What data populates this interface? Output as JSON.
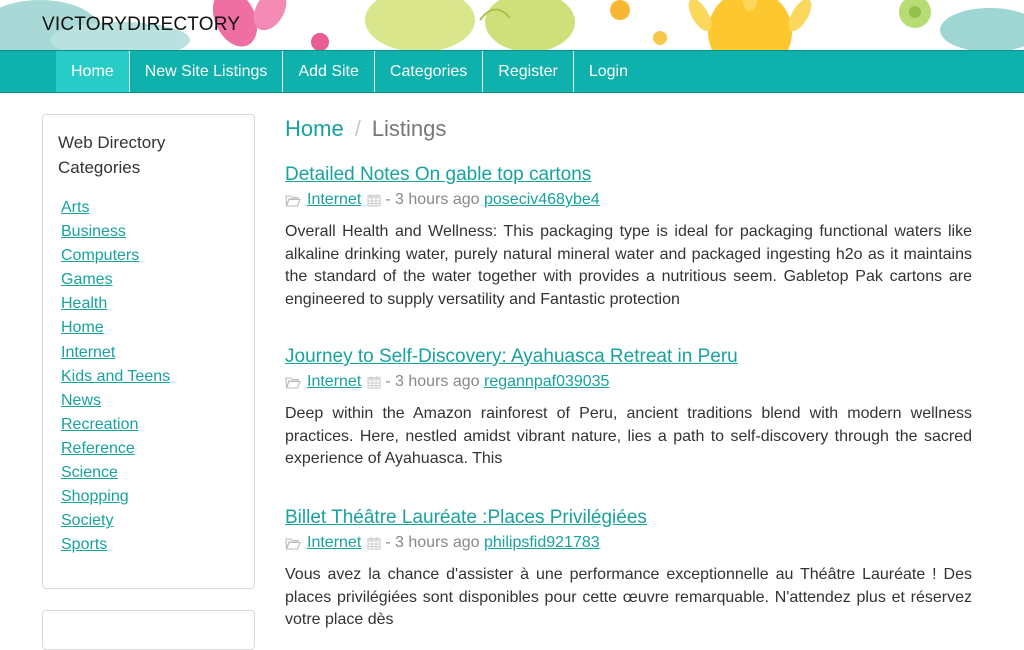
{
  "header": {
    "brand": "VICTORYDIRECTORY"
  },
  "nav": {
    "items": [
      {
        "label": "Home",
        "active": true
      },
      {
        "label": "New Site Listings"
      },
      {
        "label": "Add Site"
      },
      {
        "label": "Categories"
      },
      {
        "label": "Register"
      },
      {
        "label": "Login"
      }
    ]
  },
  "sidebar": {
    "title": "Web Directory Categories",
    "categories": [
      "Arts",
      "Business",
      "Computers",
      "Games",
      "Health",
      "Home",
      "Internet",
      "Kids and Teens",
      "News",
      "Recreation",
      "Reference",
      "Science",
      "Shopping",
      "Society",
      "Sports"
    ]
  },
  "breadcrumb": {
    "home": "Home",
    "separator": "/",
    "current": "Listings"
  },
  "listings": [
    {
      "title": "Detailed Notes On gable top cartons",
      "category": "Internet",
      "time": "- 3 hours ago",
      "user": "poseciv468ybe4",
      "description": "Overall Health and Wellness: This packaging type is ideal for packaging functional waters like alkaline drinking water, purely natural mineral water and packaged ingesting h2o as it maintains the standard of the water together with provides a nutritious seem. Gabletop Pak cartons are engineered to supply versatility and Fantastic protection"
    },
    {
      "title": "Journey to Self-Discovery: Ayahuasca Retreat in Peru",
      "category": "Internet",
      "time": "- 3 hours ago",
      "user": "regannpaf039035",
      "description": "Deep within the Amazon rainforest of Peru, ancient traditions blend with modern wellness practices. Here, nestled amidst vibrant nature, lies a path to self-discovery through the sacred experience of Ayahuasca. This"
    },
    {
      "title": "Billet Théâtre Lauréate :Places Privilégiées",
      "category": "Internet",
      "time": "- 3 hours ago",
      "user": "philipsfid921783",
      "description": "Vous avez la chance d'assister à une performance exceptionnelle au Théâtre Lauréate ! Des places privilégiées sont disponibles pour cette œuvre remarquable. N'attendez plus et réservez votre place dès"
    }
  ],
  "colors": {
    "accent": "#0fb1ac",
    "active_nav": "#28ccc6",
    "link": "#17a2a0"
  },
  "icons": {
    "category": "folder-open-icon",
    "date": "calendar-icon"
  }
}
